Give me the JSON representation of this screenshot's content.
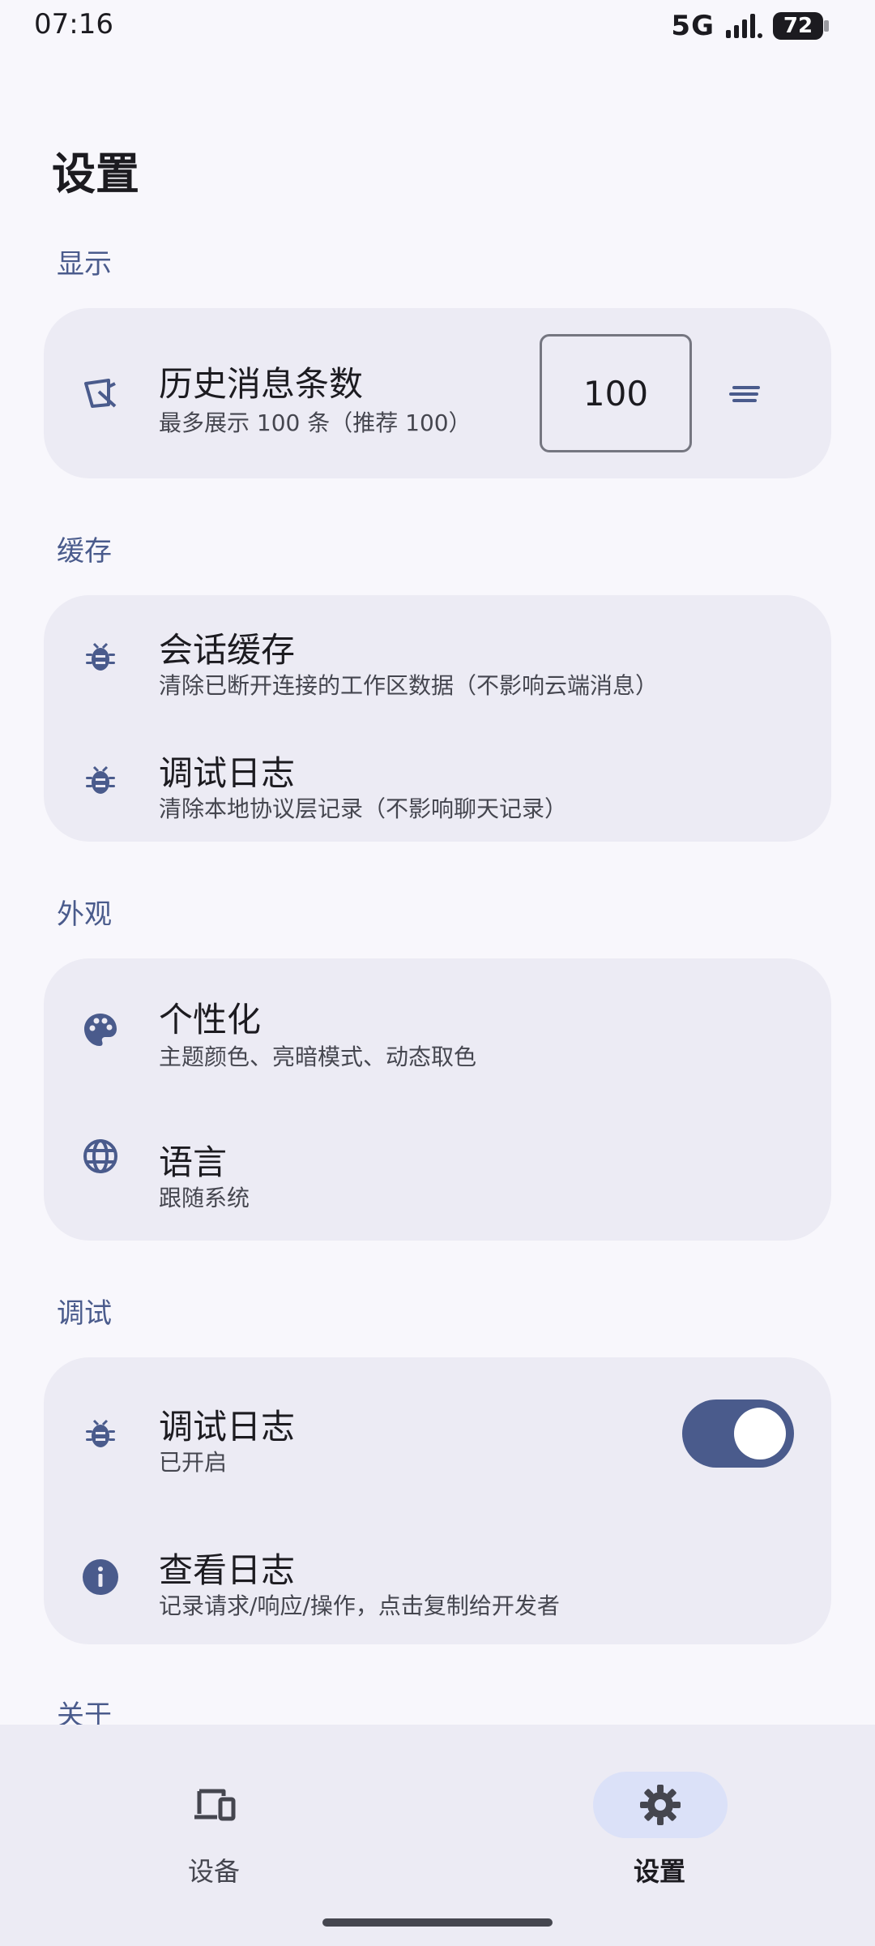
{
  "status": {
    "time": "07:16",
    "network": "5G",
    "battery": "72"
  },
  "page": {
    "title": "设置"
  },
  "sections": {
    "display": {
      "title": "显示",
      "history": {
        "title": "历史消息条数",
        "subtitle": "最多展示 100 条（推荐 100）",
        "value": "100",
        "icon": "clear-history-icon"
      }
    },
    "cache": {
      "title": "缓存",
      "session": {
        "title": "会话缓存",
        "subtitle": "清除已断开连接的工作区数据（不影响云端消息）",
        "icon": "bug-icon"
      },
      "debuglog": {
        "title": "调试日志",
        "subtitle": "清除本地协议层记录（不影响聊天记录）",
        "icon": "bug-icon"
      }
    },
    "appearance": {
      "title": "外观",
      "personalize": {
        "title": "个性化",
        "subtitle": "主题颜色、亮暗模式、动态取色",
        "icon": "palette-icon"
      },
      "language": {
        "title": "语言",
        "subtitle": "跟随系统",
        "icon": "globe-icon"
      }
    },
    "debug": {
      "title": "调试",
      "debuglog": {
        "title": "调试日志",
        "subtitle": "已开启",
        "enabled": true,
        "icon": "bug-icon"
      },
      "viewlog": {
        "title": "查看日志",
        "subtitle": "记录请求/响应/操作，点击复制给开发者",
        "icon": "info-icon"
      }
    },
    "about": {
      "title": "关于"
    }
  },
  "nav": {
    "devices": {
      "label": "设备",
      "icon": "devices-icon"
    },
    "settings": {
      "label": "设置",
      "icon": "gear-icon",
      "active": true
    }
  },
  "colors": {
    "accent": "#4a5b8c",
    "card": "#ecebf4",
    "background": "#f8f7fc",
    "active_pill": "#dbe1f8"
  }
}
